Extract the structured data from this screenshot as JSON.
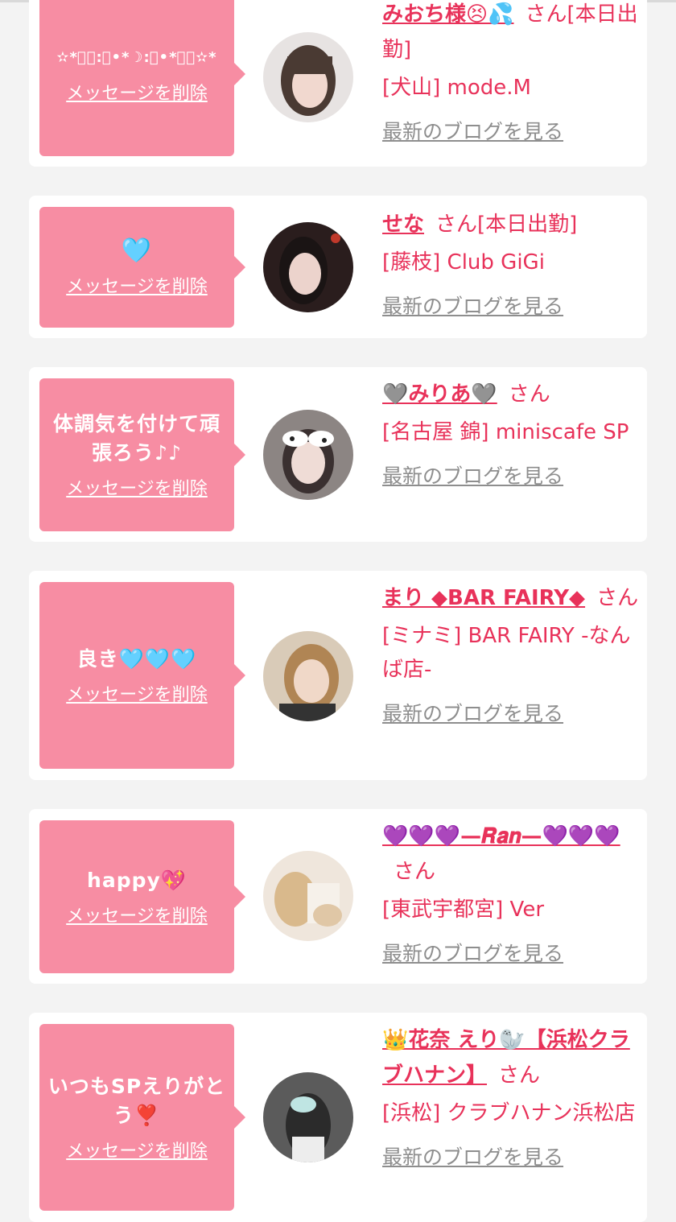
{
  "delete_label": "メッセージを削除",
  "blog_label": "最新のブログを見る",
  "san_suffix": "さん",
  "colors": {
    "accent": "#e8325a",
    "bubble": "#f78da3",
    "link_gray": "#8e8e8e"
  },
  "items": [
    {
      "message": "✫*ﾟ｡:ﾟ•*☽:ﾟ•*ﾟ｡✫*",
      "name": "みおち様😣💦",
      "status": "[本日出勤]",
      "shop": "[犬山] mode.M"
    },
    {
      "message": "🩵",
      "name": "せな",
      "status": "[本日出勤]",
      "shop": "[藤枝] Club GiGi"
    },
    {
      "message": "体調気を付けて頑張ろう♪♪",
      "name": "🩶みりあ🩶",
      "status": "",
      "shop": "[名古屋 錦] miniscafe SP"
    },
    {
      "message": "良き🩵🩵🩵",
      "name": "まり ◆BAR FAIRY◆",
      "status": "",
      "shop": "[ミナミ] BAR FAIRY -なんば店-"
    },
    {
      "message": "happy💖",
      "name": "💜💜💜—𝑹𝒂𝒏—💜💜💜",
      "status": "",
      "shop": "[東武宇都宮] Ver"
    },
    {
      "message": "いつもSPえりがとう❣️",
      "name": "👑花奈 えり🦭【浜松クラブハナン】",
      "status": "",
      "shop": "[浜松] クラブハナン浜松店"
    }
  ]
}
